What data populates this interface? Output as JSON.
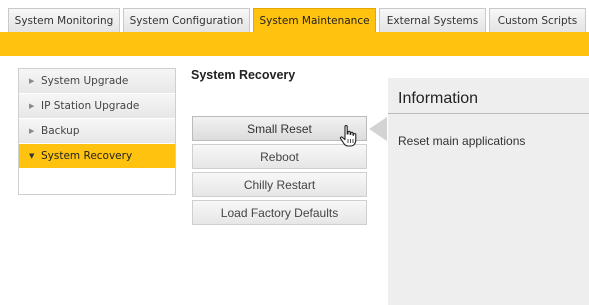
{
  "tabs": [
    {
      "label": "System Monitoring"
    },
    {
      "label": "System Configuration"
    },
    {
      "label": "System Maintenance"
    },
    {
      "label": "External Systems"
    },
    {
      "label": "Custom Scripts"
    }
  ],
  "active_tab": "System Maintenance",
  "sidebar": {
    "items": [
      {
        "label": "System Upgrade"
      },
      {
        "label": "IP Station Upgrade"
      },
      {
        "label": "Backup"
      },
      {
        "label": "System Recovery"
      }
    ],
    "active_item": "System Recovery"
  },
  "main": {
    "title": "System Recovery",
    "buttons": [
      {
        "label": "Small Reset"
      },
      {
        "label": "Reboot"
      },
      {
        "label": "Chilly Restart"
      },
      {
        "label": "Load Factory Defaults"
      }
    ],
    "selected_button": "Small Reset"
  },
  "info": {
    "title": "Information",
    "text": "Reset main applications"
  },
  "icons": {
    "menu_collapsed": "triangle-right-icon",
    "menu_expanded": "triangle-down-icon",
    "cursor": "hand-pointer-icon"
  },
  "colors": {
    "accent": "#ffc20e",
    "panel_bg": "#eeeeee"
  }
}
